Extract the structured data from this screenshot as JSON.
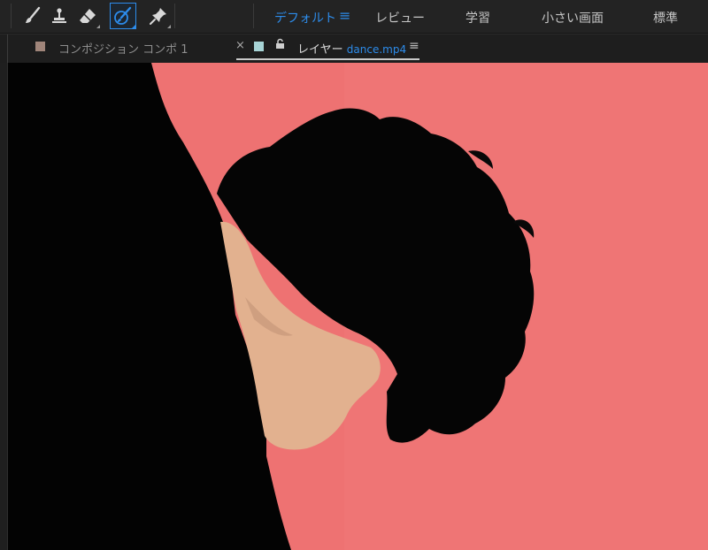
{
  "toolbar": {
    "tools": [
      {
        "name": "brush-tool-icon",
        "active": false
      },
      {
        "name": "clone-stamp-tool-icon",
        "active": false
      },
      {
        "name": "eraser-tool-icon",
        "active": false
      },
      {
        "name": "roto-brush-tool-icon",
        "active": true
      },
      {
        "name": "puppet-pin-tool-icon",
        "active": false
      }
    ],
    "workspaces": [
      {
        "label": "デフォルト",
        "active": true
      },
      {
        "label": "レビュー",
        "active": false
      },
      {
        "label": "学習",
        "active": false
      },
      {
        "label": "小さい画面",
        "active": false
      },
      {
        "label": "標準",
        "active": false
      }
    ],
    "menu_icon": "≡"
  },
  "tabs": {
    "composition_tab": {
      "label": "コンポジション コンポ 1",
      "swatch_color": "#a0857a"
    },
    "close_glyph": "×",
    "layer_tab": {
      "label": "レイヤー",
      "file": "dance.mp4",
      "swatch_color": "#a7d4d6"
    },
    "menu_icon": "≡"
  },
  "colors": {
    "accent": "#2d8ceb",
    "background_pink": "#ee7272",
    "foreground_black": "#030303"
  }
}
